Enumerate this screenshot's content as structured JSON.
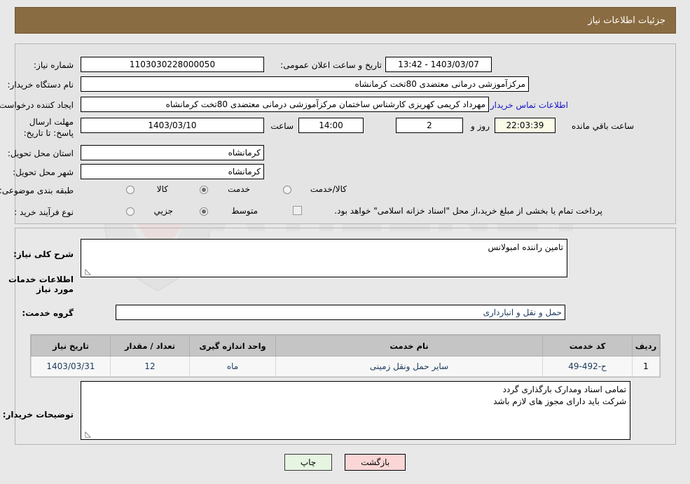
{
  "header": {
    "title": "جزئیات اطلاعات نیاز"
  },
  "top_section": {
    "need_number_label": "شماره نیاز:",
    "need_number_value": "1103030228000050",
    "public_announce_label": "تاریخ و ساعت اعلان عمومی:",
    "public_announce_value": "1403/03/07 - 13:42",
    "buyer_org_label": "نام دستگاه خریدار:",
    "buyer_org_value": "مرکزآموزشی درمانی معتضدی 80تخت کرمانشاه",
    "requester_label": "ایجاد کننده درخواست:",
    "requester_value": "مهرداد کریمی کهریزی کارشناس ساختمان  مرکزآموزشی درمانی معتضدی 80تخت کرمانشاه",
    "contact_link": "اطلاعات تماس خریدار",
    "deadline_label": "مهلت ارسال پاسخ: تا تاریخ:",
    "deadline_date": "1403/03/10",
    "hour_label": "ساعت",
    "deadline_time": "14:00",
    "days_value": "2",
    "days_label": "روز و",
    "countdown_value": "22:03:39",
    "countdown_label": "ساعت باقي مانده",
    "province_label": "استان محل تحویل:",
    "province_value": "کرمانشاه",
    "city_label": "شهر محل تحویل:",
    "city_value": "کرمانشاه",
    "category_label": "طبقه بندی موضوعی:",
    "category_options": [
      {
        "label": "کالا",
        "selected": false
      },
      {
        "label": "خدمت",
        "selected": true
      },
      {
        "label": "کالا/خدمت",
        "selected": false
      }
    ],
    "purchase_type_label": "نوع فرآیند خرید :",
    "purchase_type_options": [
      {
        "label": "جزیي",
        "selected": false
      },
      {
        "label": "متوسط",
        "selected": true
      }
    ],
    "treasury_checkbox_label": "پرداخت تمام یا بخشی از مبلغ خرید،از محل \"اسناد خزانه اسلامی\" خواهد بود.",
    "treasury_checked": false
  },
  "middle_section": {
    "general_desc_label": "شرح کلی نیاز:",
    "general_desc_value": "تامین راننده امبولانس",
    "services_heading": "اطلاعات خدمات مورد نیاز",
    "service_group_label": "گروه خدمت:",
    "service_group_value": "حمل و نقل و انبارداری"
  },
  "table": {
    "columns": [
      "ردیف",
      "کد خدمت",
      "نام خدمت",
      "واحد اندازه گیری",
      "تعداد / مقدار",
      "تاریخ نیاز"
    ],
    "rows": [
      {
        "row_number": "1",
        "service_code": "ح-492-49",
        "service_name": "سایر حمل ونقل زمینی",
        "unit": "ماه",
        "quantity": "12",
        "need_date": "1403/03/31"
      }
    ]
  },
  "buyer_notes": {
    "label": "توضیحات خریدار:",
    "lines": [
      "تمامی اسناد ومدارک بارگذاری گردد",
      "شرکت باید دارای مجوز های لازم باشد"
    ]
  },
  "footer": {
    "print_label": "چاپ",
    "back_label": "بازگشت"
  },
  "watermark": {
    "text": "AriaTender.net"
  },
  "colors": {
    "header_bar": "#8a6c42",
    "page_background": "#e8e8e8",
    "panel_background": "#e4e4e4",
    "link": "#1414c8",
    "table_header": "#c5c5c5",
    "table_cell_text": "#1b3a5c",
    "print_button": "#e6f4e2",
    "back_button": "#fad6d6",
    "countdown_background": "#fbfbe8"
  }
}
